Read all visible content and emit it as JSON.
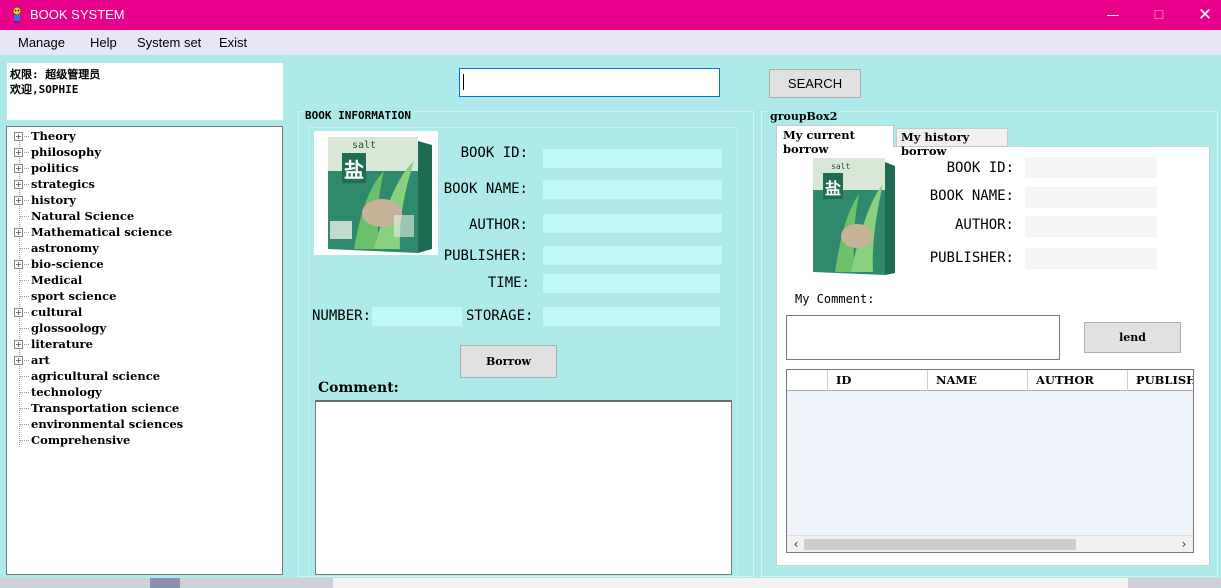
{
  "window": {
    "title": "BOOK SYSTEM",
    "min_glyph": "—",
    "max_glyph": "☐",
    "close_glyph": "✕"
  },
  "menu": [
    "Manage",
    "Help",
    "System set",
    "Exist"
  ],
  "user": {
    "role": "权限: 超级管理员",
    "welcome": "欢迎,SOPHIE"
  },
  "tree": [
    {
      "label": "Theory",
      "expandable": true
    },
    {
      "label": "philosophy",
      "expandable": true
    },
    {
      "label": "politics",
      "expandable": true
    },
    {
      "label": "strategics",
      "expandable": true
    },
    {
      "label": "history",
      "expandable": true
    },
    {
      "label": "Natural Science",
      "expandable": false
    },
    {
      "label": "Mathematical science",
      "expandable": true
    },
    {
      "label": "astronomy",
      "expandable": false
    },
    {
      "label": "bio-science",
      "expandable": true
    },
    {
      "label": "Medical",
      "expandable": false
    },
    {
      "label": "sport science",
      "expandable": false
    },
    {
      "label": "cultural",
      "expandable": true
    },
    {
      "label": "glossoology",
      "expandable": false
    },
    {
      "label": "literature",
      "expandable": true
    },
    {
      "label": "art",
      "expandable": true
    },
    {
      "label": "agricultural science",
      "expandable": false
    },
    {
      "label": "technology",
      "expandable": false
    },
    {
      "label": "Transportation science",
      "expandable": false
    },
    {
      "label": "environmental sciences",
      "expandable": false
    },
    {
      "label": "Comprehensive",
      "expandable": false
    }
  ],
  "search": {
    "value": "",
    "button": "SEARCH"
  },
  "book_info": {
    "title": "BOOK INFORMATION",
    "labels": {
      "book_id": "BOOK ID:",
      "book_name": "BOOK NAME:",
      "author": "AUTHOR:",
      "publisher": "PUBLISHER:",
      "time": "TIME:",
      "number": "NUMBER:",
      "storage": "STORAGE:"
    },
    "borrow": "Borrow",
    "comment_label": "Comment:",
    "cover": {
      "title_cn": "盐",
      "title_en": "salt",
      "icon": "book-cover-image"
    }
  },
  "group2": {
    "title": "groupBox2",
    "tabs": [
      "My current borrow",
      "My history borrow"
    ],
    "labels": {
      "book_id": "BOOK ID:",
      "book_name": "BOOK NAME:",
      "author": "AUTHOR:",
      "publisher": "PUBLISHER:",
      "my_comment": "My Comment:"
    },
    "lend": "lend",
    "columns": [
      "",
      "ID",
      "NAME",
      "AUTHOR",
      "PUBLISHER"
    ],
    "scroll_left": "‹",
    "scroll_right": "›"
  },
  "colors": {
    "titlebar": "#e6008a",
    "panel": "#aeeaea",
    "field": "#c0f8f8",
    "focus": "#0078d7"
  }
}
